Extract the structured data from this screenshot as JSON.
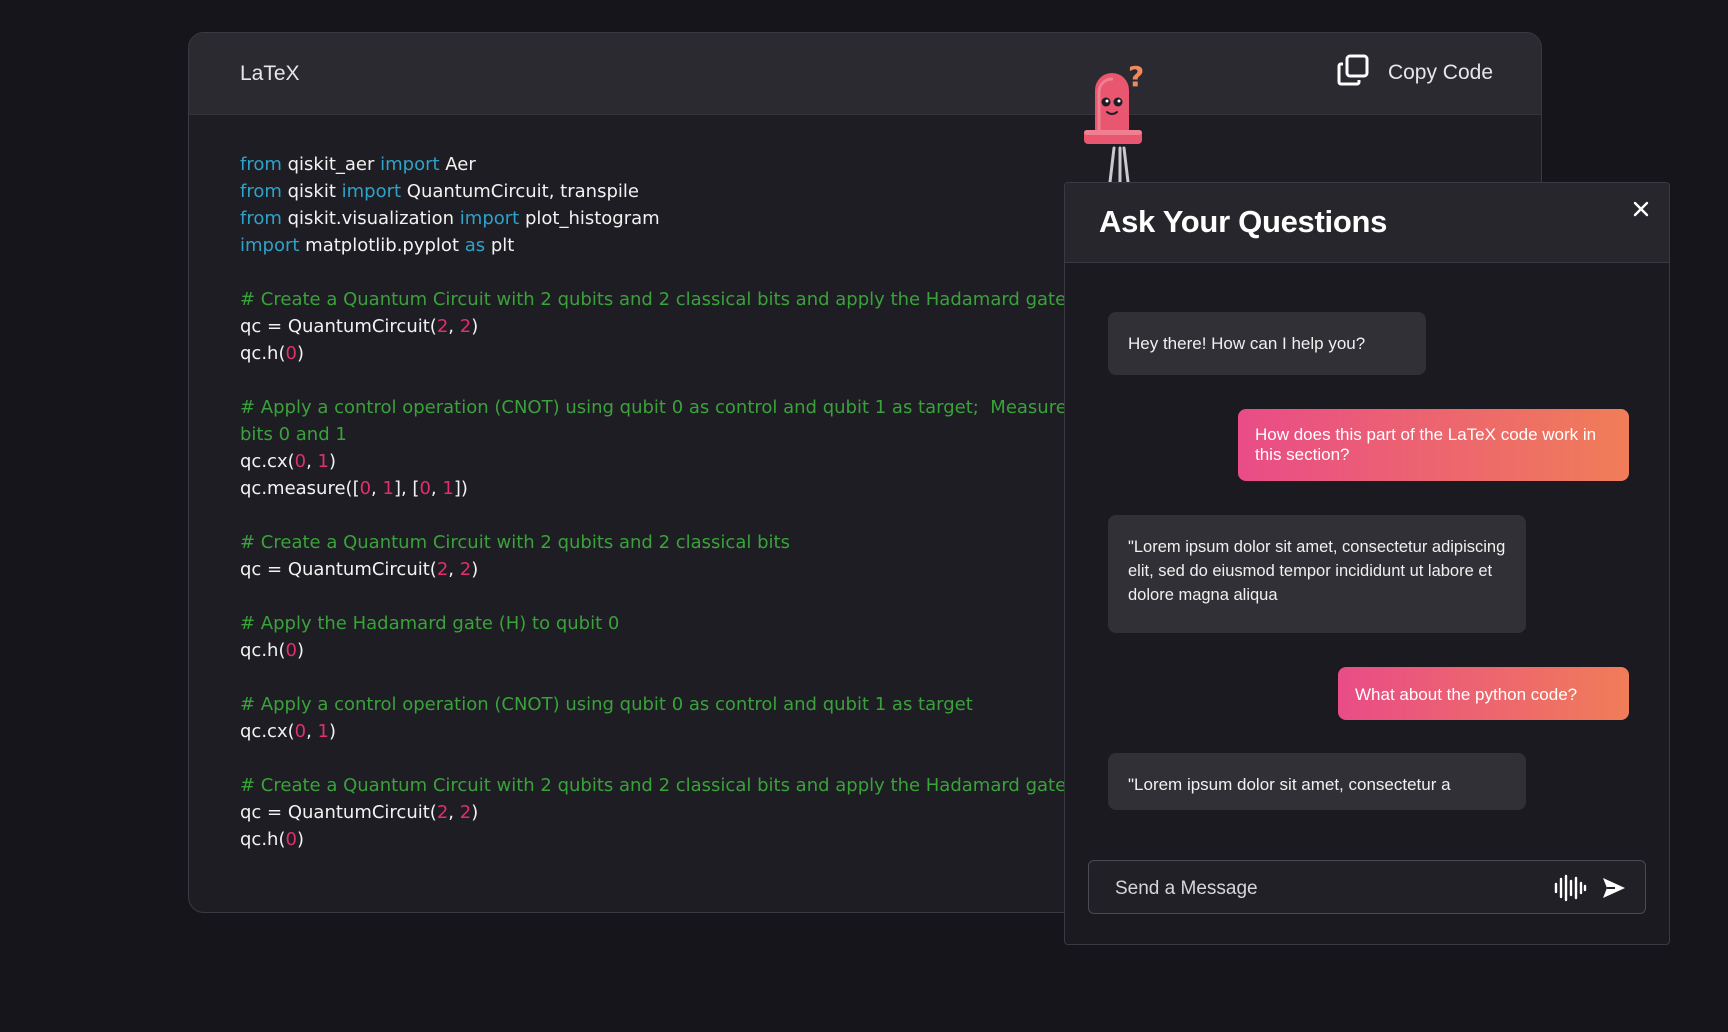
{
  "code_card": {
    "language": "LaTeX",
    "copy_label": "Copy Code",
    "lines": [
      [
        {
          "t": "from",
          "c": "kw"
        },
        {
          "t": " qiskit_aer ",
          "c": "tx"
        },
        {
          "t": "import",
          "c": "kw"
        },
        {
          "t": " Aer",
          "c": "tx"
        }
      ],
      [
        {
          "t": "from",
          "c": "kw"
        },
        {
          "t": " qiskit ",
          "c": "tx"
        },
        {
          "t": "import",
          "c": "kw"
        },
        {
          "t": " QuantumCircuit, transpile",
          "c": "tx"
        }
      ],
      [
        {
          "t": "from",
          "c": "kw"
        },
        {
          "t": " qiskit.visualization ",
          "c": "tx"
        },
        {
          "t": "import",
          "c": "kw"
        },
        {
          "t": " plot_histogram",
          "c": "tx"
        }
      ],
      [
        {
          "t": "import",
          "c": "kw"
        },
        {
          "t": " matplotlib.pyplot ",
          "c": "tx"
        },
        {
          "t": "as",
          "c": "kw"
        },
        {
          "t": " plt",
          "c": "tx"
        }
      ],
      [],
      [
        {
          "t": "# Create a Quantum Circuit with 2 qubits and 2 classical bits and apply the Hadamard gate",
          "c": "cm"
        }
      ],
      [
        {
          "t": "qc = QuantumCircuit(",
          "c": "tx"
        },
        {
          "t": "2",
          "c": "num"
        },
        {
          "t": ", ",
          "c": "tx"
        },
        {
          "t": "2",
          "c": "num"
        },
        {
          "t": ")",
          "c": "tx"
        }
      ],
      [
        {
          "t": "qc.h(",
          "c": "tx"
        },
        {
          "t": "0",
          "c": "num"
        },
        {
          "t": ")",
          "c": "tx"
        }
      ],
      [],
      [
        {
          "t": "# Apply a control operation (CNOT) using qubit 0 as control and qubit 1 as target;  Measure",
          "c": "cm"
        }
      ],
      [
        {
          "t": "bits 0 and 1",
          "c": "cm"
        }
      ],
      [
        {
          "t": "qc.cx(",
          "c": "tx"
        },
        {
          "t": "0",
          "c": "num"
        },
        {
          "t": ", ",
          "c": "tx"
        },
        {
          "t": "1",
          "c": "num"
        },
        {
          "t": ")",
          "c": "tx"
        }
      ],
      [
        {
          "t": "qc.measure([",
          "c": "tx"
        },
        {
          "t": "0",
          "c": "num"
        },
        {
          "t": ", ",
          "c": "tx"
        },
        {
          "t": "1",
          "c": "num"
        },
        {
          "t": "], [",
          "c": "tx"
        },
        {
          "t": "0",
          "c": "num"
        },
        {
          "t": ", ",
          "c": "tx"
        },
        {
          "t": "1",
          "c": "num"
        },
        {
          "t": "])",
          "c": "tx"
        }
      ],
      [],
      [
        {
          "t": "# Create a Quantum Circuit with 2 qubits and 2 classical bits",
          "c": "cm"
        }
      ],
      [
        {
          "t": "qc = QuantumCircuit(",
          "c": "tx"
        },
        {
          "t": "2",
          "c": "num"
        },
        {
          "t": ", ",
          "c": "tx"
        },
        {
          "t": "2",
          "c": "num"
        },
        {
          "t": ")",
          "c": "tx"
        }
      ],
      [],
      [
        {
          "t": "# Apply the Hadamard gate (H) to qubit 0",
          "c": "cm"
        }
      ],
      [
        {
          "t": "qc.h(",
          "c": "tx"
        },
        {
          "t": "0",
          "c": "num"
        },
        {
          "t": ")",
          "c": "tx"
        }
      ],
      [],
      [
        {
          "t": "# Apply a control operation (CNOT) using qubit 0 as control and qubit 1 as target",
          "c": "cm"
        }
      ],
      [
        {
          "t": "qc.cx(",
          "c": "tx"
        },
        {
          "t": "0",
          "c": "num"
        },
        {
          "t": ", ",
          "c": "tx"
        },
        {
          "t": "1",
          "c": "num"
        },
        {
          "t": ")",
          "c": "tx"
        }
      ],
      [],
      [
        {
          "t": "# Create a Quantum Circuit with 2 qubits and 2 classical bits and apply the Hadamard gate",
          "c": "cm"
        }
      ],
      [
        {
          "t": "qc = QuantumCircuit(",
          "c": "tx"
        },
        {
          "t": "2",
          "c": "num"
        },
        {
          "t": ", ",
          "c": "tx"
        },
        {
          "t": "2",
          "c": "num"
        },
        {
          "t": ")",
          "c": "tx"
        }
      ],
      [
        {
          "t": "qc.h(",
          "c": "tx"
        },
        {
          "t": "0",
          "c": "num"
        },
        {
          "t": ")",
          "c": "tx"
        }
      ]
    ]
  },
  "mascot": {
    "icon": "mascot-question-icon",
    "question_mark": "?"
  },
  "chat": {
    "title": "Ask Your Questions",
    "close_icon": "close-icon",
    "messages": [
      {
        "role": "bot",
        "text": "Hey there! How can I help you?"
      },
      {
        "role": "user",
        "text": "How does this part of the LaTeX code work in this section?"
      },
      {
        "role": "bot",
        "text": "\"Lorem ipsum dolor sit amet, consectetur adipiscing elit, sed do eiusmod tempor incididunt ut labore et dolore magna aliqua"
      },
      {
        "role": "user",
        "text": "What about the python code?"
      },
      {
        "role": "bot",
        "text": "\"Lorem ipsum dolor sit amet, consectetur a"
      }
    ],
    "input": {
      "placeholder": "Send a Message",
      "value": ""
    },
    "voice_icon": "waveform-icon",
    "send_icon": "send-icon"
  },
  "colors": {
    "background": "#15151b",
    "keyword": "#2ea2c9",
    "comment": "#3aa23a",
    "number": "#e0306a",
    "user_bubble_start": "#e94c87",
    "user_bubble_end": "#f07d58"
  }
}
